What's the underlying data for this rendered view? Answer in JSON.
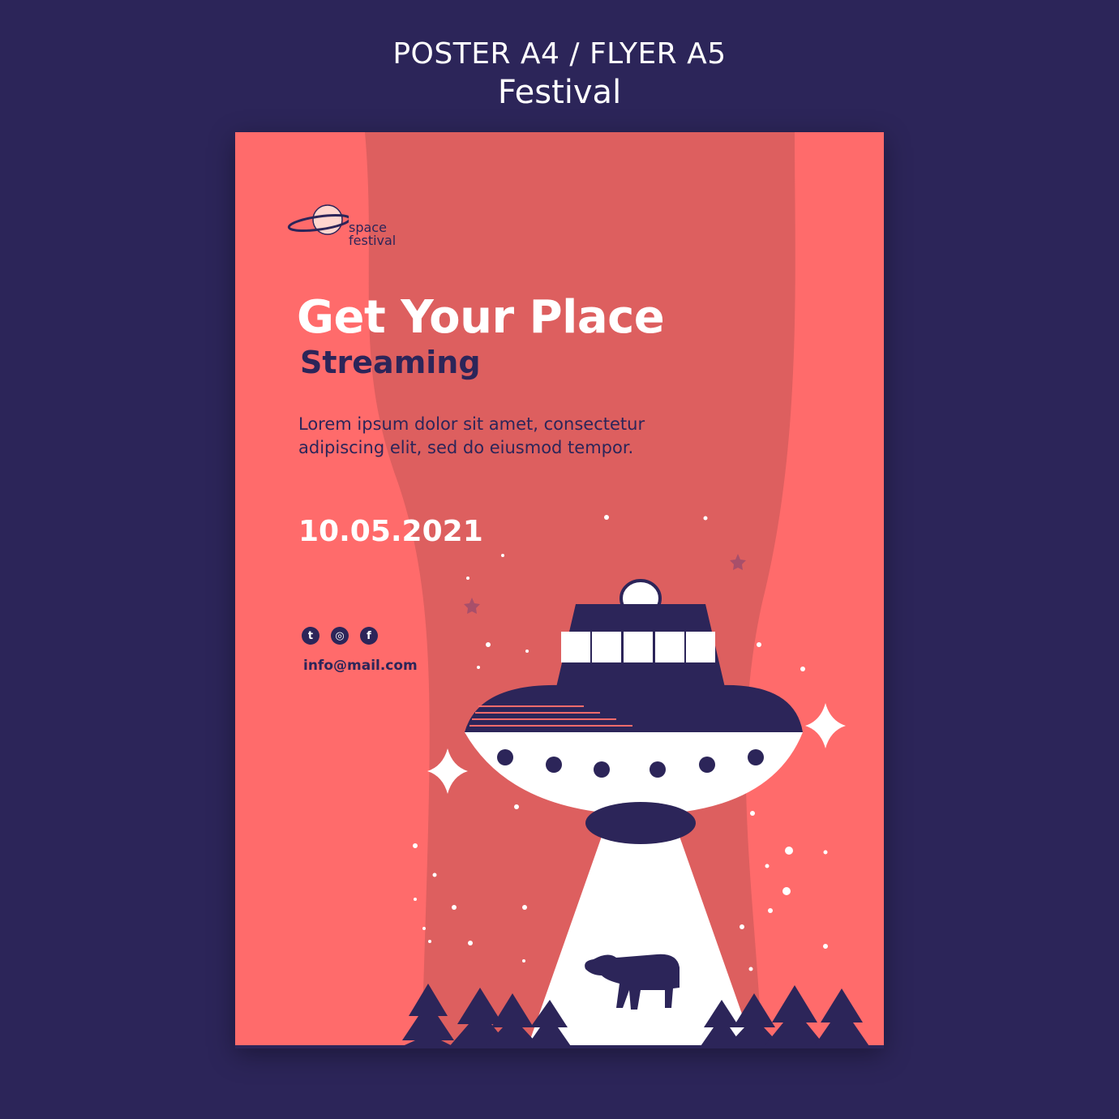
{
  "header": {
    "line1": "POSTER A4 / FLYER A5",
    "line2": "Festival"
  },
  "poster": {
    "logo_text_line1": "space",
    "logo_text_line2": "festival",
    "title": "Get Your Place",
    "subtitle": "Streaming",
    "description": "Lorem ipsum dolor sit amet, consectetur adipiscing elit, sed do eiusmod tempor.",
    "date": "10.05.2021",
    "social_icons": [
      "twitter-icon",
      "instagram-icon",
      "facebook-icon"
    ],
    "social_glyphs": [
      "t",
      "◎",
      "f"
    ],
    "email": "info@mail.com"
  },
  "colors": {
    "background": "#2c2559",
    "poster": "#ff6b6b",
    "poster_shade": "#dd5f5f",
    "ink": "#2c2559",
    "white": "#ffffff"
  }
}
